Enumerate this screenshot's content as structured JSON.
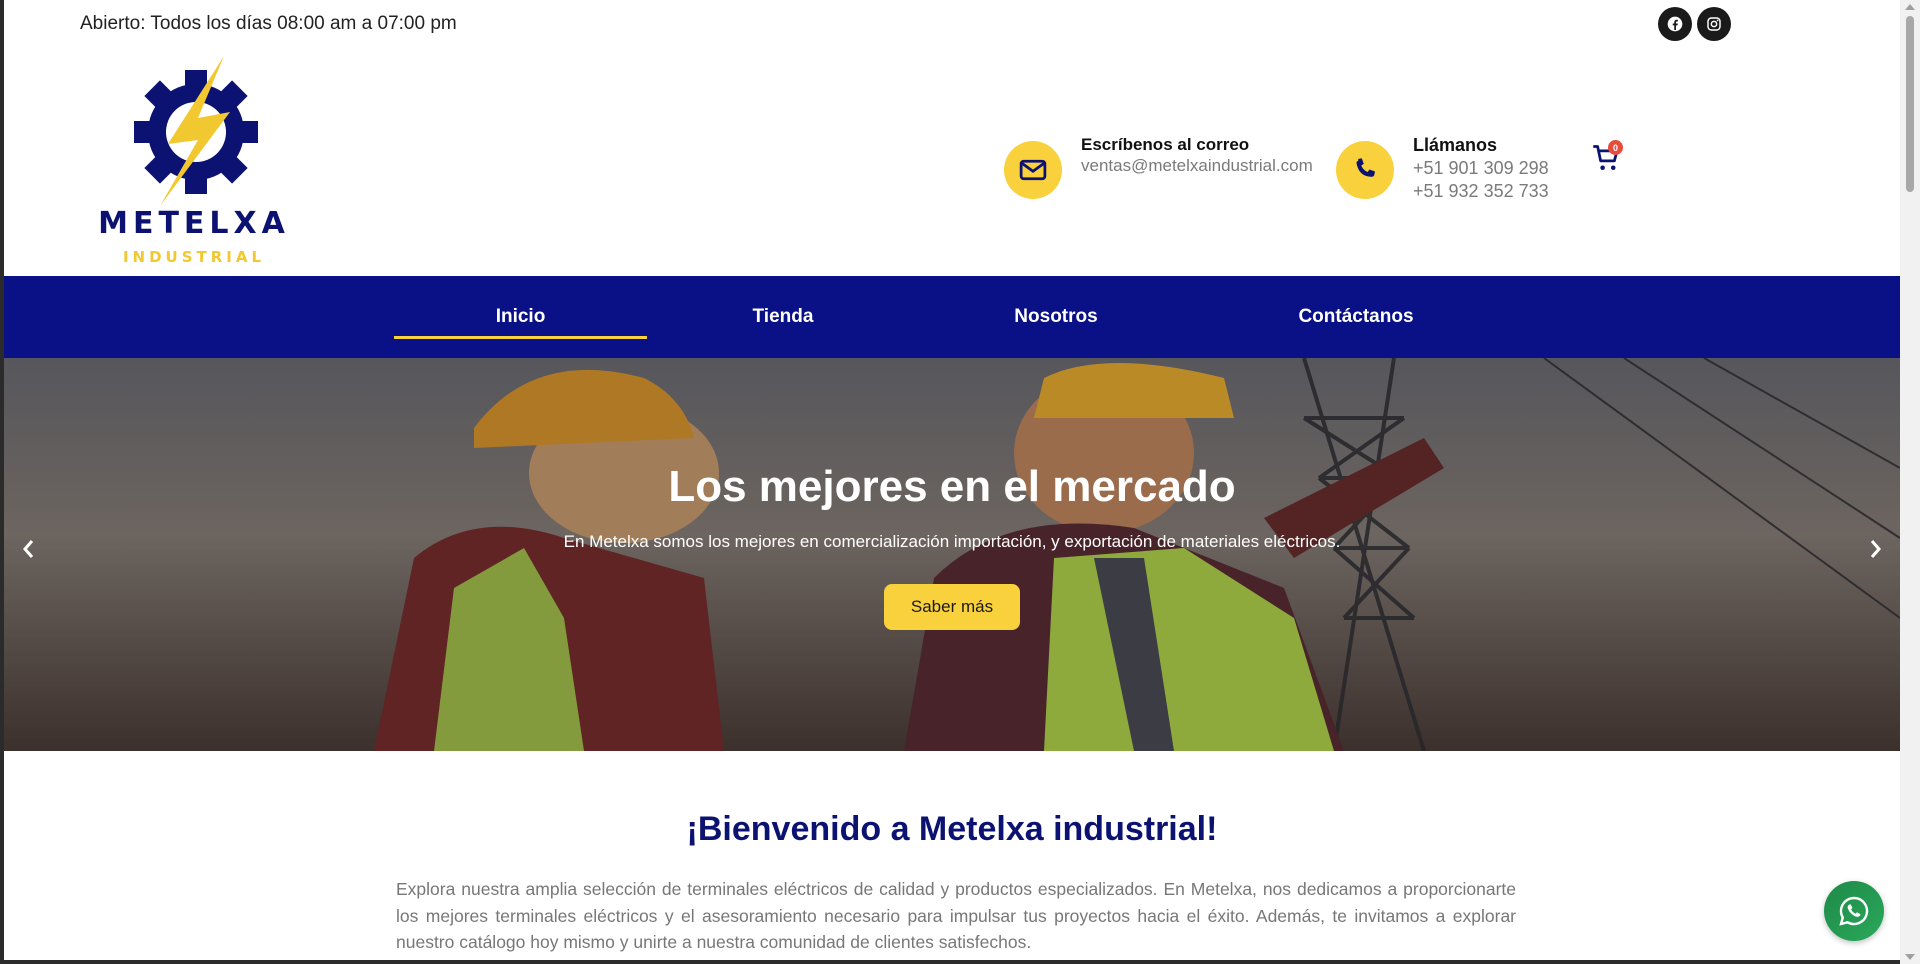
{
  "topbar": {
    "hours": "Abierto: Todos los días 08:00 am a 07:00 pm",
    "social": [
      {
        "icon": "facebook-icon"
      },
      {
        "icon": "instagram-icon"
      }
    ]
  },
  "logo": {
    "name": "METELXA",
    "sub": "INDUSTRIAL",
    "colors": {
      "primary": "#0c1272",
      "accent": "#f2c830"
    }
  },
  "contact": {
    "email": {
      "title": "Escríbenos al correo",
      "value": "ventas@metelxaindustrial.com",
      "icon": "envelope-icon"
    },
    "phone": {
      "title": "Llámanos",
      "lines": [
        "+51 901 309 298",
        "+51 932 352 733"
      ],
      "icon": "phone-icon"
    },
    "cart": {
      "count": "0",
      "icon": "cart-icon"
    }
  },
  "nav": {
    "items": [
      {
        "label": "Inicio",
        "active": true
      },
      {
        "label": "Tienda",
        "active": false
      },
      {
        "label": "Nosotros",
        "active": false
      },
      {
        "label": "Contáctanos",
        "active": false
      }
    ],
    "color": "#0a1085",
    "accent": "#f9d13c"
  },
  "hero": {
    "title": "Los mejores en el mercado",
    "subtitle": "En Metelxa somos los mejores en comercialización importación, y exportación de materiales eléctricos.",
    "button": "Saber más"
  },
  "welcome": {
    "title": "¡Bienvenido a Metelxa industrial!",
    "text": "Explora nuestra amplia selección de terminales eléctricos de calidad y productos especializados. En Metelxa, nos dedicamos a proporcionarte los mejores terminales eléctricos y el asesoramiento necesario para impulsar tus proyectos hacia el éxito. Además, te invitamos a explorar nuestro catálogo hoy mismo y unirte a nuestra comunidad de clientes satisfechos."
  }
}
